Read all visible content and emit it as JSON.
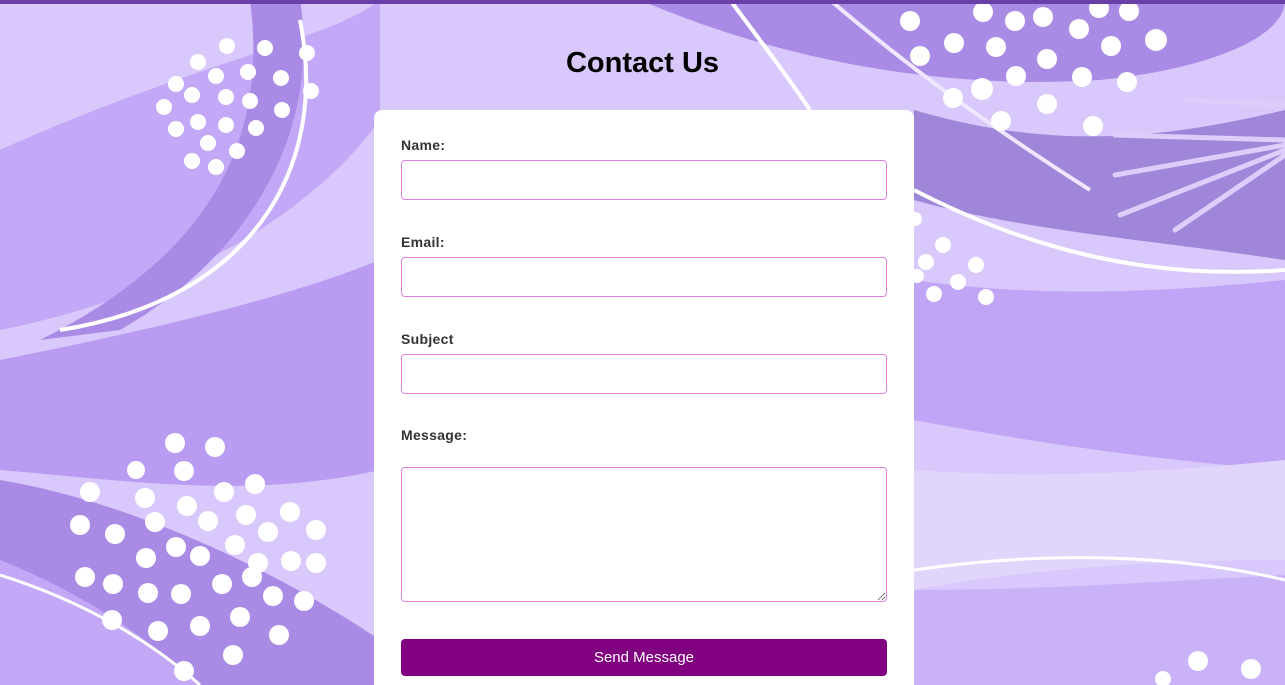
{
  "page": {
    "title": "Contact Us"
  },
  "colors": {
    "background": "#d9c8fb",
    "accent_bar": "#6a3fa8",
    "input_border": "#e27fe0",
    "button": "#800080",
    "button_text": "#ffffff",
    "card": "#ffffff"
  },
  "form": {
    "name_label": "Name:",
    "name_value": "",
    "email_label": "Email:",
    "email_value": "",
    "subject_label": "Subject",
    "subject_value": "",
    "message_label": "Message:",
    "message_value": "",
    "submit_label": "Send Message"
  }
}
